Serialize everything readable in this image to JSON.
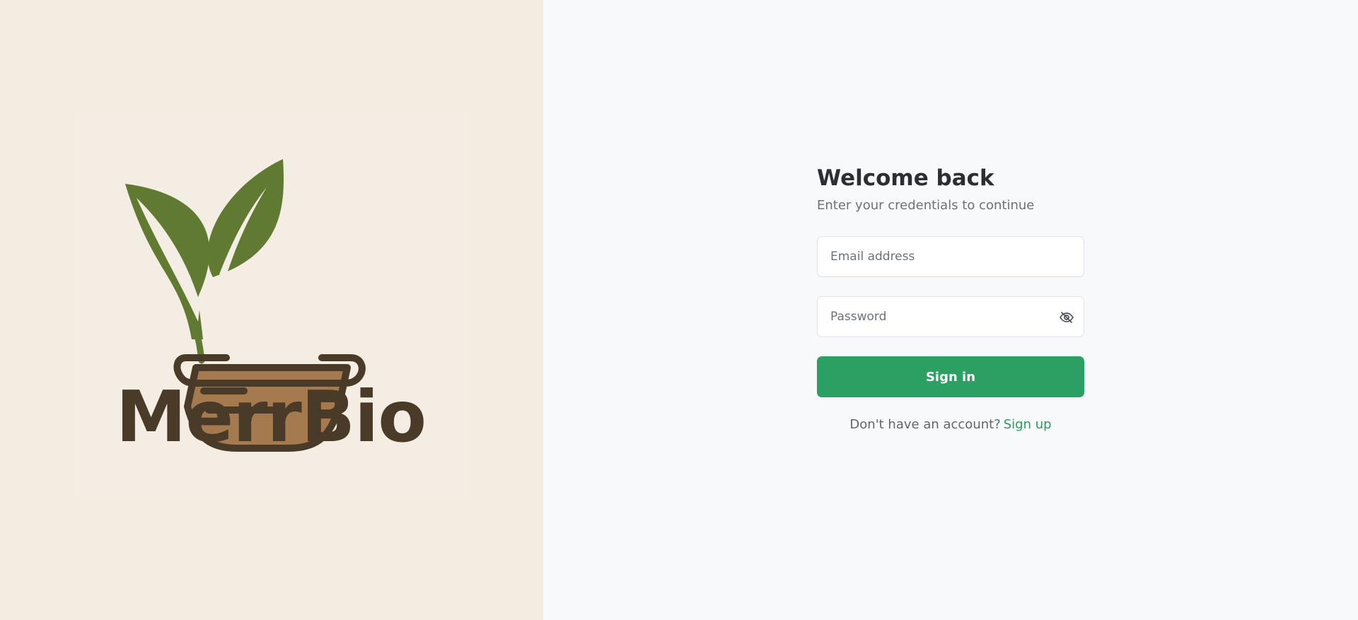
{
  "brand": {
    "name": "MerrBio",
    "colors": {
      "panel_background": "#f3ece1",
      "leaf": "#617a31",
      "basket_outline": "#4a3a28",
      "basket_fill": "#a57a4f",
      "wordmark": "#4a3a28"
    }
  },
  "login": {
    "title": "Welcome back",
    "subtitle": "Enter your credentials to continue",
    "email_placeholder": "Email address",
    "password_placeholder": "Password",
    "password_toggle_icon": "eye-off-icon",
    "submit_label": "Sign in",
    "signup_prompt": "Don't have an account?",
    "signup_link": "Sign up",
    "colors": {
      "accent": "#2ca063",
      "link": "#2a9a5c",
      "background": "#f8f9fa"
    }
  }
}
